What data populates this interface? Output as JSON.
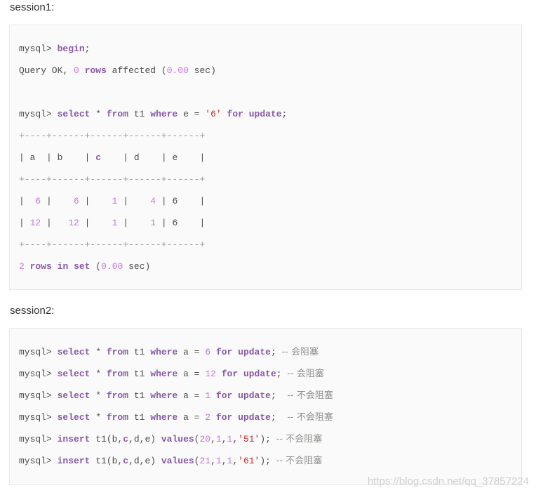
{
  "session1": {
    "label": "session1:",
    "lines": [
      [
        [
          "p",
          "mysql> "
        ],
        [
          "k",
          "begin"
        ],
        [
          "p",
          ";"
        ]
      ],
      [
        [
          "p",
          "Query OK, "
        ],
        [
          "n",
          "0"
        ],
        [
          "p",
          " "
        ],
        [
          "k",
          "rows"
        ],
        [
          "p",
          " affected ("
        ],
        [
          "n",
          "0.00"
        ],
        [
          "p",
          " sec)"
        ]
      ],
      [],
      [
        [
          "p",
          "mysql> "
        ],
        [
          "k",
          "select"
        ],
        [
          "p",
          " * "
        ],
        [
          "k",
          "from"
        ],
        [
          "p",
          " t1 "
        ],
        [
          "k",
          "where"
        ],
        [
          "p",
          " e = "
        ],
        [
          "s",
          "'6'"
        ],
        [
          "p",
          " "
        ],
        [
          "k",
          "for"
        ],
        [
          "p",
          " "
        ],
        [
          "k",
          "update"
        ],
        [
          "p",
          ";"
        ]
      ],
      [
        [
          "d",
          "+----+------+------+------+------+"
        ]
      ],
      [
        [
          "p",
          "| a  | b    | "
        ],
        [
          "k",
          "c"
        ],
        [
          "p",
          "    | d    | e    |"
        ]
      ],
      [
        [
          "d",
          "+----+------+------+------+------+"
        ]
      ],
      [
        [
          "p",
          "|  "
        ],
        [
          "n",
          "6"
        ],
        [
          "p",
          " |    "
        ],
        [
          "n",
          "6"
        ],
        [
          "p",
          " |    "
        ],
        [
          "n",
          "1"
        ],
        [
          "p",
          " |    "
        ],
        [
          "n",
          "4"
        ],
        [
          "p",
          " | 6    |"
        ]
      ],
      [
        [
          "p",
          "| "
        ],
        [
          "n",
          "12"
        ],
        [
          "p",
          " |   "
        ],
        [
          "n",
          "12"
        ],
        [
          "p",
          " |    "
        ],
        [
          "n",
          "1"
        ],
        [
          "p",
          " |    "
        ],
        [
          "n",
          "1"
        ],
        [
          "p",
          " | 6    |"
        ]
      ],
      [
        [
          "d",
          "+----+------+------+------+------+"
        ]
      ],
      [
        [
          "n",
          "2"
        ],
        [
          "p",
          " "
        ],
        [
          "k",
          "rows"
        ],
        [
          "p",
          " "
        ],
        [
          "k",
          "in"
        ],
        [
          "p",
          " "
        ],
        [
          "k",
          "set"
        ],
        [
          "p",
          " ("
        ],
        [
          "n",
          "0.00"
        ],
        [
          "p",
          " sec)"
        ]
      ]
    ]
  },
  "session2": {
    "label": "session2:",
    "lines": [
      [
        [
          "p",
          "mysql> "
        ],
        [
          "k",
          "select"
        ],
        [
          "p",
          " * "
        ],
        [
          "k",
          "from"
        ],
        [
          "p",
          " t1 "
        ],
        [
          "k",
          "where"
        ],
        [
          "p",
          " a = "
        ],
        [
          "n",
          "6"
        ],
        [
          "p",
          " "
        ],
        [
          "k",
          "for"
        ],
        [
          "p",
          " "
        ],
        [
          "k",
          "update"
        ],
        [
          "p",
          "; "
        ],
        [
          "c",
          "-- 会阻塞"
        ]
      ],
      [
        [
          "p",
          "mysql> "
        ],
        [
          "k",
          "select"
        ],
        [
          "p",
          " * "
        ],
        [
          "k",
          "from"
        ],
        [
          "p",
          " t1 "
        ],
        [
          "k",
          "where"
        ],
        [
          "p",
          " a = "
        ],
        [
          "n",
          "12"
        ],
        [
          "p",
          " "
        ],
        [
          "k",
          "for"
        ],
        [
          "p",
          " "
        ],
        [
          "k",
          "update"
        ],
        [
          "p",
          "; "
        ],
        [
          "c",
          "-- 会阻塞"
        ]
      ],
      [
        [
          "p",
          "mysql> "
        ],
        [
          "k",
          "select"
        ],
        [
          "p",
          " * "
        ],
        [
          "k",
          "from"
        ],
        [
          "p",
          " t1 "
        ],
        [
          "k",
          "where"
        ],
        [
          "p",
          " a = "
        ],
        [
          "n",
          "1"
        ],
        [
          "p",
          " "
        ],
        [
          "k",
          "for"
        ],
        [
          "p",
          " "
        ],
        [
          "k",
          "update"
        ],
        [
          "p",
          ";  "
        ],
        [
          "c",
          "-- 不会阻塞"
        ]
      ],
      [
        [
          "p",
          "mysql> "
        ],
        [
          "k",
          "select"
        ],
        [
          "p",
          " * "
        ],
        [
          "k",
          "from"
        ],
        [
          "p",
          " t1 "
        ],
        [
          "k",
          "where"
        ],
        [
          "p",
          " a = "
        ],
        [
          "n",
          "2"
        ],
        [
          "p",
          " "
        ],
        [
          "k",
          "for"
        ],
        [
          "p",
          " "
        ],
        [
          "k",
          "update"
        ],
        [
          "p",
          ";  "
        ],
        [
          "c",
          "-- 不会阻塞"
        ]
      ],
      [
        [
          "p",
          "mysql> "
        ],
        [
          "k",
          "insert"
        ],
        [
          "p",
          " t1(b,"
        ],
        [
          "k",
          "c"
        ],
        [
          "p",
          ",d,e) "
        ],
        [
          "k",
          "values"
        ],
        [
          "p",
          "("
        ],
        [
          "n",
          "20"
        ],
        [
          "p",
          ","
        ],
        [
          "n",
          "1"
        ],
        [
          "p",
          ","
        ],
        [
          "n",
          "1"
        ],
        [
          "p",
          ","
        ],
        [
          "s",
          "'51'"
        ],
        [
          "p",
          "); "
        ],
        [
          "c",
          "-- 不会阻塞"
        ]
      ],
      [
        [
          "p",
          "mysql> "
        ],
        [
          "k",
          "insert"
        ],
        [
          "p",
          " t1(b,"
        ],
        [
          "k",
          "c"
        ],
        [
          "p",
          ",d,e) "
        ],
        [
          "k",
          "values"
        ],
        [
          "p",
          "("
        ],
        [
          "n",
          "21"
        ],
        [
          "p",
          ","
        ],
        [
          "n",
          "1"
        ],
        [
          "p",
          ","
        ],
        [
          "n",
          "1"
        ],
        [
          "p",
          ","
        ],
        [
          "s",
          "'61'"
        ],
        [
          "p",
          "); "
        ],
        [
          "c",
          "-- 不会阻塞"
        ]
      ]
    ]
  },
  "watermark": "https://blog.csdn.net/qq_37857224"
}
